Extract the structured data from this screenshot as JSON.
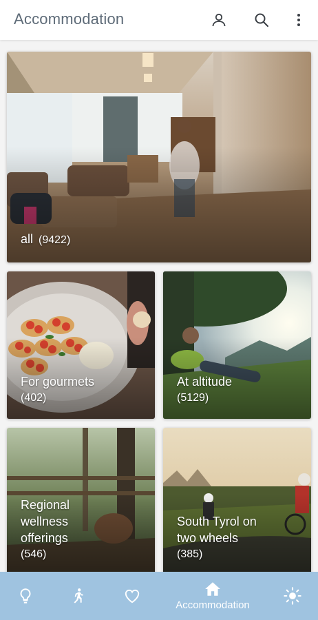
{
  "header": {
    "title": "Accommodation",
    "icons": [
      "user-icon",
      "search-icon",
      "more-vert-icon"
    ]
  },
  "cards": [
    {
      "name": "all",
      "count": "(9422)"
    },
    {
      "name": "For gourmets",
      "count": "(402)"
    },
    {
      "name": "At altitude",
      "count": "(5129)"
    },
    {
      "name": "Regional\nwellness\nofferings",
      "count": "(546)"
    },
    {
      "name": "South Tyrol on\ntwo wheels",
      "count": "(385)"
    }
  ],
  "bottom_nav": {
    "items": [
      {
        "icon": "lightbulb-icon",
        "label": ""
      },
      {
        "icon": "running-person-icon",
        "label": ""
      },
      {
        "icon": "heart-icon",
        "label": ""
      },
      {
        "icon": "home-icon",
        "label": "Accommodation",
        "active": true
      },
      {
        "icon": "sun-icon",
        "label": ""
      }
    ]
  },
  "colors": {
    "title": "#5e6b78",
    "nav_background": "#9fc3e0",
    "nav_foreground": "#ffffff"
  }
}
